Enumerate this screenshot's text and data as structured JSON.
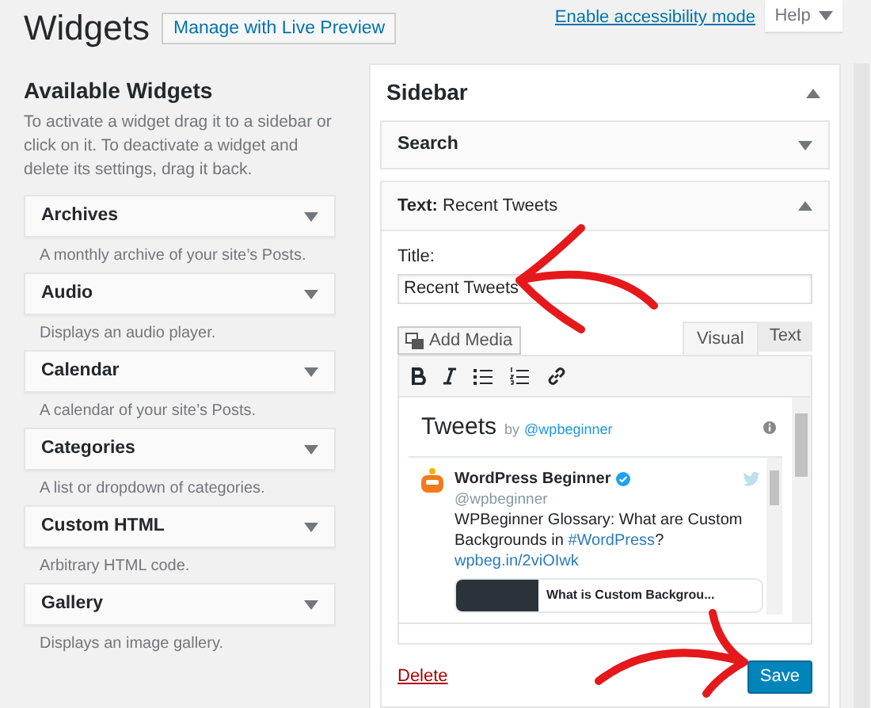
{
  "header": {
    "title": "Widgets",
    "live_preview_button": "Manage with Live Preview",
    "accessibility_link": "Enable accessibility mode",
    "help_tab": "Help"
  },
  "available": {
    "title": "Available Widgets",
    "description": "To activate a widget drag it to a sidebar or click on it. To deactivate a widget and delete its settings, drag it back.",
    "widgets": [
      {
        "name": "Archives",
        "description": "A monthly archive of your site’s Posts."
      },
      {
        "name": "Audio",
        "description": "Displays an audio player."
      },
      {
        "name": "Calendar",
        "description": "A calendar of your site’s Posts."
      },
      {
        "name": "Categories",
        "description": "A list or dropdown of categories."
      },
      {
        "name": "Custom HTML",
        "description": "Arbitrary HTML code."
      },
      {
        "name": "Gallery",
        "description": "Displays an image gallery."
      }
    ]
  },
  "sidebar": {
    "title": "Sidebar",
    "expanded": true,
    "widgets": [
      {
        "kind": "collapsed",
        "title": "Search",
        "expanded": false
      },
      {
        "kind": "editor",
        "type_label": "Text:",
        "title": "Recent Tweets",
        "expanded": true,
        "field_label": "Title:",
        "field_value": "Recent Tweets",
        "add_media": "Add Media",
        "tabs": [
          {
            "label": "Visual",
            "selected": true
          },
          {
            "label": "Text",
            "selected": false
          }
        ],
        "embed": {
          "heading": "Tweets",
          "by": "by",
          "account": "@wpbeginner",
          "author": "WordPress Beginner",
          "handle": "@wpbeginner",
          "text": "WPBeginner Glossary: What are Custom Backgrounds in",
          "hashtag": "#WordPress",
          "text_end": "?",
          "link": "wpbeg.in/2viOIwk",
          "card_title": "What is Custom Backgrou..."
        },
        "delete": "Delete",
        "save": "Save"
      }
    ]
  }
}
